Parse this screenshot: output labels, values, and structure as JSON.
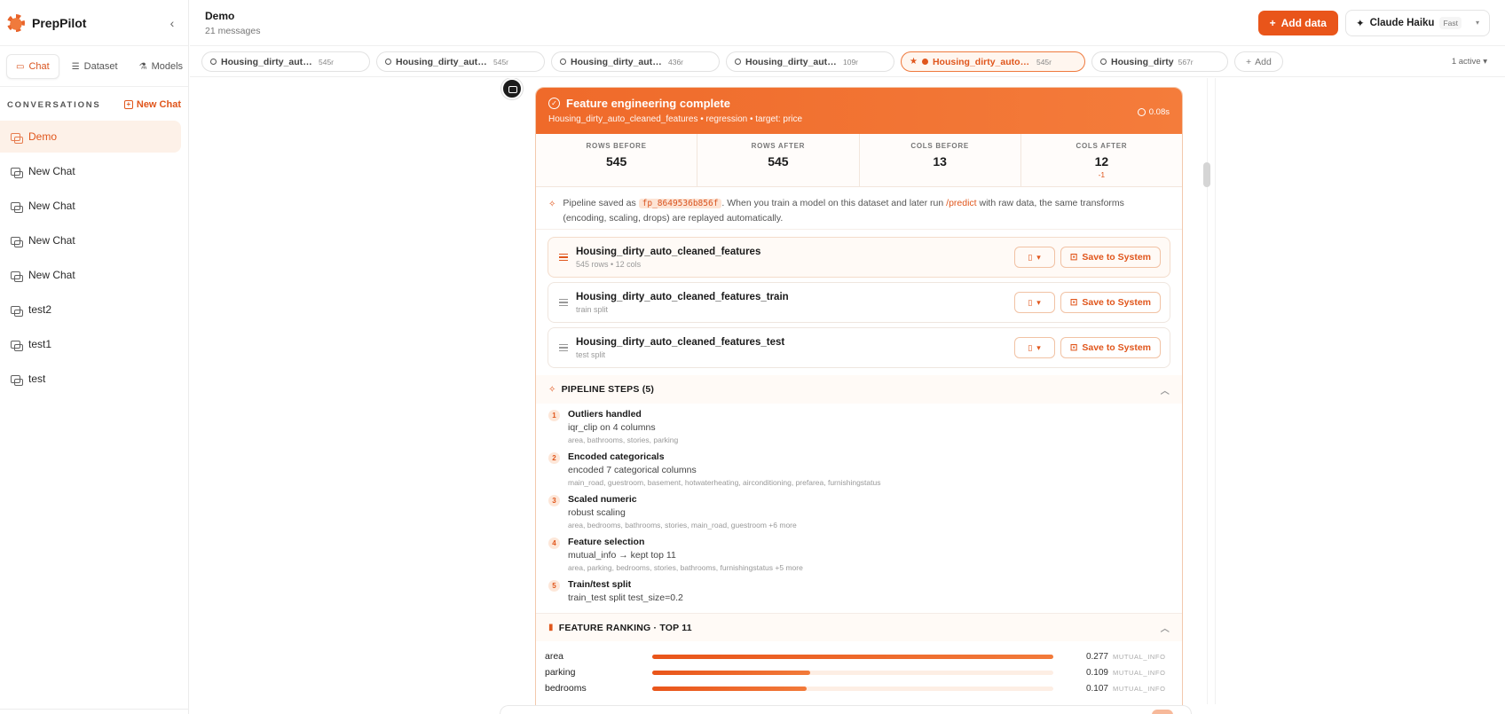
{
  "app": {
    "name": "PrepPilot",
    "collapse_icon": "chevron-left-icon"
  },
  "modes": [
    {
      "label": "Chat",
      "icon": "chat-icon",
      "active": true
    },
    {
      "label": "Dataset",
      "icon": "table-icon",
      "active": false
    },
    {
      "label": "Models",
      "icon": "flask-icon",
      "active": false
    }
  ],
  "sidebar": {
    "conversations_title": "CONVERSATIONS",
    "new_chat_label": "New Chat",
    "conversations": [
      {
        "label": "Demo",
        "active": true
      },
      {
        "label": "New Chat",
        "active": false
      },
      {
        "label": "New Chat",
        "active": false
      },
      {
        "label": "New Chat",
        "active": false
      },
      {
        "label": "New Chat",
        "active": false
      },
      {
        "label": "test2",
        "active": false
      },
      {
        "label": "test1",
        "active": false
      },
      {
        "label": "test",
        "active": false
      }
    ]
  },
  "header": {
    "title": "Demo",
    "subtitle": "21 messages",
    "add_data_label": "Add data",
    "model_name": "Claude Haiku",
    "model_badge": "Fast"
  },
  "tabs": [
    {
      "name": "Housing_dirty_auto_cleaned",
      "count": "545r",
      "active": false
    },
    {
      "name": "Housing_dirty_auto_cleaned",
      "count": "545r",
      "active": false
    },
    {
      "name": "Housing_dirty_auto_cleaned",
      "count": "436r",
      "active": false
    },
    {
      "name": "Housing_dirty_auto_cleaned",
      "count": "109r",
      "active": false
    },
    {
      "name": "Housing_dirty_auto_cleaned_features",
      "count": "545r",
      "active": true
    },
    {
      "name": "Housing_dirty",
      "count": "567r",
      "active": false
    }
  ],
  "tabs_add_label": "Add",
  "tabs_active_count": "1 active",
  "card": {
    "title": "Feature engineering complete",
    "subtitle": "Housing_dirty_auto_cleaned_features • regression • target: price",
    "time": "0.08s",
    "stats": [
      {
        "label": "ROWS BEFORE",
        "value": "545",
        "delta": ""
      },
      {
        "label": "ROWS AFTER",
        "value": "545",
        "delta": ""
      },
      {
        "label": "COLS BEFORE",
        "value": "13",
        "delta": ""
      },
      {
        "label": "COLS AFTER",
        "value": "12",
        "delta": "-1"
      }
    ],
    "note_prefix": "Pipeline saved as",
    "note_code": "fp_8649536b856f",
    "note_mid": ". When you train a model on this dataset and later run",
    "note_link": "/predict",
    "note_suffix": "with raw data, the same transforms (encoding, scaling, drops) are replayed automatically.",
    "datasets": [
      {
        "name": "Housing_dirty_auto_cleaned_features",
        "sub": "545 rows • 12 cols",
        "save_label": "Save to System"
      },
      {
        "name": "Housing_dirty_auto_cleaned_features_train",
        "sub": "train split",
        "save_label": "Save to System"
      },
      {
        "name": "Housing_dirty_auto_cleaned_features_test",
        "sub": "test split",
        "save_label": "Save to System"
      }
    ],
    "pipeline_title": "PIPELINE STEPS (5)",
    "steps": [
      {
        "num": "1",
        "title": "Outliers handled",
        "desc": "iqr_clip on 4 columns",
        "cols": "area, bathrooms, stories, parking"
      },
      {
        "num": "2",
        "title": "Encoded categoricals",
        "desc": "encoded 7 categorical columns",
        "cols": "main_road, guestroom, basement, hotwaterheating, airconditioning, prefarea, furnishingstatus"
      },
      {
        "num": "3",
        "title": "Scaled numeric",
        "desc": "robust scaling",
        "cols": "area, bedrooms, bathrooms, stories, main_road, guestroom +6 more"
      },
      {
        "num": "4",
        "title": "Feature selection",
        "desc": "mutual_info → kept top 11",
        "cols": "area, parking, bedrooms, stories, bathrooms, furnishingstatus +5 more"
      },
      {
        "num": "5",
        "title": "Train/test split",
        "desc": "train_test split test_size=0.2",
        "cols": ""
      }
    ],
    "ranking_title": "FEATURE RANKING · TOP 11",
    "features": [
      {
        "name": "area",
        "value": "0.277",
        "fraction": 1.0,
        "metric": "MUTUAL_INFO"
      },
      {
        "name": "parking",
        "value": "0.109",
        "fraction": 0.394,
        "metric": "MUTUAL_INFO"
      },
      {
        "name": "bedrooms",
        "value": "0.107",
        "fraction": 0.386,
        "metric": "MUTUAL_INFO"
      }
    ]
  }
}
